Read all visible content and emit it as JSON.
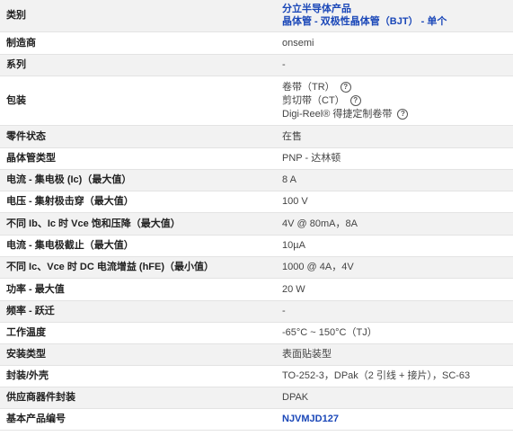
{
  "rows": [
    {
      "label": "类别",
      "lines": [
        "分立半导体产品",
        "晶体管 - 双极性晶体管（BJT） - 单个"
      ]
    },
    {
      "label": "制造商",
      "value": "onsemi"
    },
    {
      "label": "系列",
      "value": "-"
    },
    {
      "label": "包装",
      "packaging": [
        "卷带（TR）",
        "剪切带（CT）",
        "Digi-Reel® 得捷定制卷带"
      ]
    },
    {
      "label": "零件状态",
      "value": "在售"
    },
    {
      "label": "晶体管类型",
      "value": "PNP - 达林顿"
    },
    {
      "label": "电流 - 集电极 (Ic)（最大值）",
      "value": "8 A"
    },
    {
      "label": "电压 - 集射极击穿（最大值）",
      "value": "100 V"
    },
    {
      "label": "不同 Ib、Ic 时 Vce 饱和压降（最大值）",
      "value": "4V @ 80mA，8A"
    },
    {
      "label": "电流 - 集电极截止（最大值）",
      "value": "10µA"
    },
    {
      "label": "不同 Ic、Vce 时 DC 电流增益 (hFE)（最小值）",
      "value": "1000 @ 4A，4V"
    },
    {
      "label": "功率 - 最大值",
      "value": "20 W"
    },
    {
      "label": "频率 - 跃迁",
      "value": "-"
    },
    {
      "label": "工作温度",
      "value": "-65°C ~ 150°C（TJ）"
    },
    {
      "label": "安装类型",
      "value": "表面贴装型"
    },
    {
      "label": "封装/外壳",
      "value": "TO-252-3，DPak（2 引线 + 接片），SC-63"
    },
    {
      "label": "供应商器件封装",
      "value": "DPAK"
    },
    {
      "label": "基本产品编号",
      "value": "NJVMJD127"
    }
  ],
  "help_icon_glyph": "?"
}
